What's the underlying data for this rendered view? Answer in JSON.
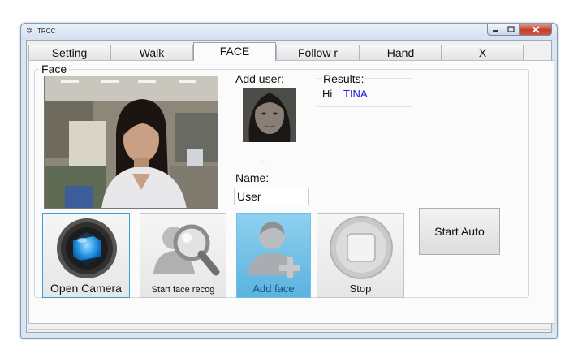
{
  "window": {
    "title": "TRCC"
  },
  "tabs": [
    {
      "label": "Setting"
    },
    {
      "label": "Walk"
    },
    {
      "label": "FACE"
    },
    {
      "label": "Follow r"
    },
    {
      "label": "Hand"
    },
    {
      "label": "X"
    }
  ],
  "face_group": {
    "label": "Face",
    "add_user_label": "Add user:",
    "dash": "-",
    "name_label": "Name:",
    "name_value": "User",
    "results_label": "Results:",
    "results_greeting": "Hi",
    "results_name": "TINA"
  },
  "buttons": {
    "open_camera": "Open Camera",
    "start_face_recog": "Start face recog",
    "add_face": "Add face",
    "stop": "Stop",
    "start_auto": "Start Auto"
  },
  "colors": {
    "result_name": "#1a1ae0",
    "add_face_bg": "#5ab3e0",
    "focus_border": "#3c9bd9"
  }
}
